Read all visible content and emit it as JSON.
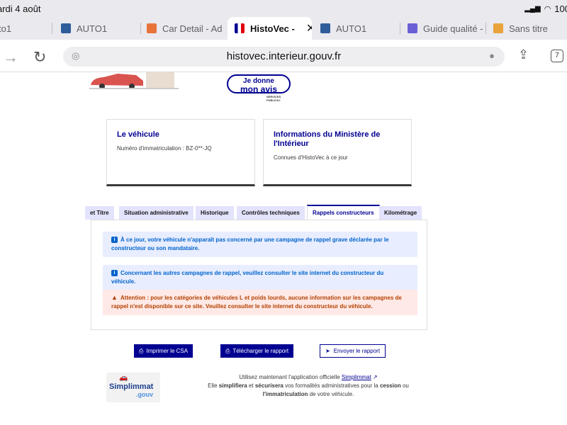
{
  "status": {
    "date": "ardi 4 août",
    "battery": "100"
  },
  "browser": {
    "tabs": [
      {
        "title": "to1",
        "fav": "#888"
      },
      {
        "title": "AUTO1",
        "fav": "#2f5d9a"
      },
      {
        "title": "Car Detail - Ad",
        "fav": "#e8743b"
      },
      {
        "title": "HistoVec -",
        "fav": "#000091"
      },
      {
        "title": "AUTO1",
        "fav": "#2f5d9a"
      },
      {
        "title": "Guide qualité -",
        "fav": "#6b5fd6"
      },
      {
        "title": "Sans titre",
        "fav": "#e8a33b"
      }
    ],
    "url": "histovec.interieur.gouv.fr",
    "tab_count": "7"
  },
  "avis": {
    "line1": "Je donne",
    "line2": "mon avis",
    "services": "SERVICES PUBLICS+"
  },
  "cards": {
    "vehicle": {
      "title": "Le véhicule",
      "sub": "Numéro d'immatriculation : BZ-0**-JQ"
    },
    "ministry": {
      "title": "Informations du Ministère de l'Intérieur",
      "sub": "Connues d'HistoVec à ce jour"
    }
  },
  "page_tabs": [
    "et Titre",
    "Situation administrative",
    "Historique",
    "Contrôles techniques",
    "Rappels constructeurs",
    "Kilométrage"
  ],
  "alerts": {
    "a1": "À ce jour, votre véhicule n'apparaît pas concerné par une campagne de rappel grave déclarée par le constructeur ou son mandataire.",
    "a2": "Concernant les autres campagnes de rappel, veuillez consulter le site internet du constructeur du véhicule.",
    "a3": "Attention : pour les catégories de véhicules L et poids lourds, aucune information sur les campagnes de rappel n'est disponible sur ce site. Veuillez consulter le site internet du constructeur du véhicule."
  },
  "buttons": {
    "print": "Imprimer le CSA",
    "download": "Télécharger le rapport",
    "send": "Envoyer le rapport"
  },
  "footer": {
    "line1_pre": "Utilisez maintenant l'application officielle ",
    "app": "Simplimmat",
    "l2a": "Elle ",
    "l2b": "simplifiera",
    "l2c": " et ",
    "l2d": "sécurisera",
    "l2e": " vos formalités administratives pour la ",
    "l2f": "cession",
    "l2g": " ou",
    "l3a": "l'immatriculation",
    "l3b": " de votre véhicule."
  },
  "logo": {
    "name": "Simplimmat",
    "gouv": ".gouv"
  }
}
